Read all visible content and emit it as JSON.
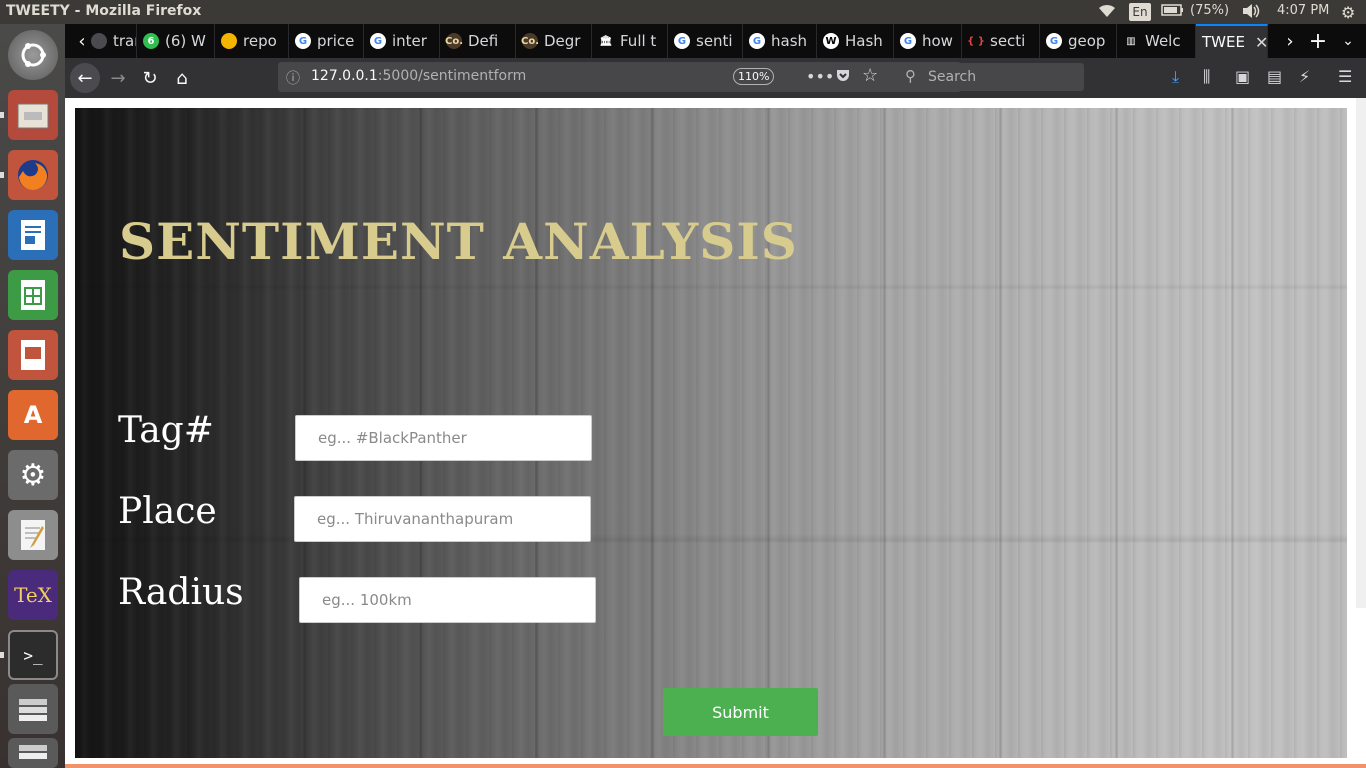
{
  "system": {
    "window_title": "TWEETY - Mozilla Firefox",
    "keyboard_layout": "En",
    "battery": "(75%)",
    "clock": "4:07 PM"
  },
  "tabs": [
    {
      "label": "trans",
      "icon": "translate-icon"
    },
    {
      "label": "(6) W",
      "icon": "whatsapp-icon",
      "icon_text": "6"
    },
    {
      "label": "repo",
      "icon": "google-drive-icon"
    },
    {
      "label": "price",
      "icon": "google-icon",
      "icon_text": "G"
    },
    {
      "label": "inter",
      "icon": "google-icon",
      "icon_text": "G"
    },
    {
      "label": "Defi",
      "icon": "co-icon",
      "icon_text": "Co."
    },
    {
      "label": "Degr",
      "icon": "co-icon",
      "icon_text": "Co."
    },
    {
      "label": "Full t",
      "icon": "bank-icon",
      "icon_text": "🏛"
    },
    {
      "label": "senti",
      "icon": "google-icon",
      "icon_text": "G"
    },
    {
      "label": "hash",
      "icon": "google-icon",
      "icon_text": "G"
    },
    {
      "label": "Hash",
      "icon": "wikipedia-icon",
      "icon_text": "W"
    },
    {
      "label": "how",
      "icon": "google-icon",
      "icon_text": "G"
    },
    {
      "label": "secti",
      "icon": "braces-icon",
      "icon_text": "{ }"
    },
    {
      "label": "geop",
      "icon": "google-icon",
      "icon_text": "G"
    },
    {
      "label": "Welc",
      "icon": "book-icon",
      "icon_text": "▥"
    },
    {
      "label": "TWEE",
      "icon": "",
      "active": true
    }
  ],
  "navigation": {
    "url_host": "127.0.0.1",
    "url_path": ":5000/sentimentform",
    "zoom": "110%",
    "search_placeholder": "Search"
  },
  "form": {
    "title": "SENTIMENT ANALYSIS",
    "tag_label": "Tag#",
    "tag_placeholder": "eg... #BlackPanther",
    "place_label": "Place",
    "place_placeholder": "eg... Thiruvananthapuram",
    "radius_label": "Radius",
    "radius_placeholder": "eg... 100km",
    "submit_label": "Submit"
  },
  "colors": {
    "title": "#d8cb8e",
    "submit": "#4caf50",
    "active_tab_accent": "#0a84ff"
  }
}
